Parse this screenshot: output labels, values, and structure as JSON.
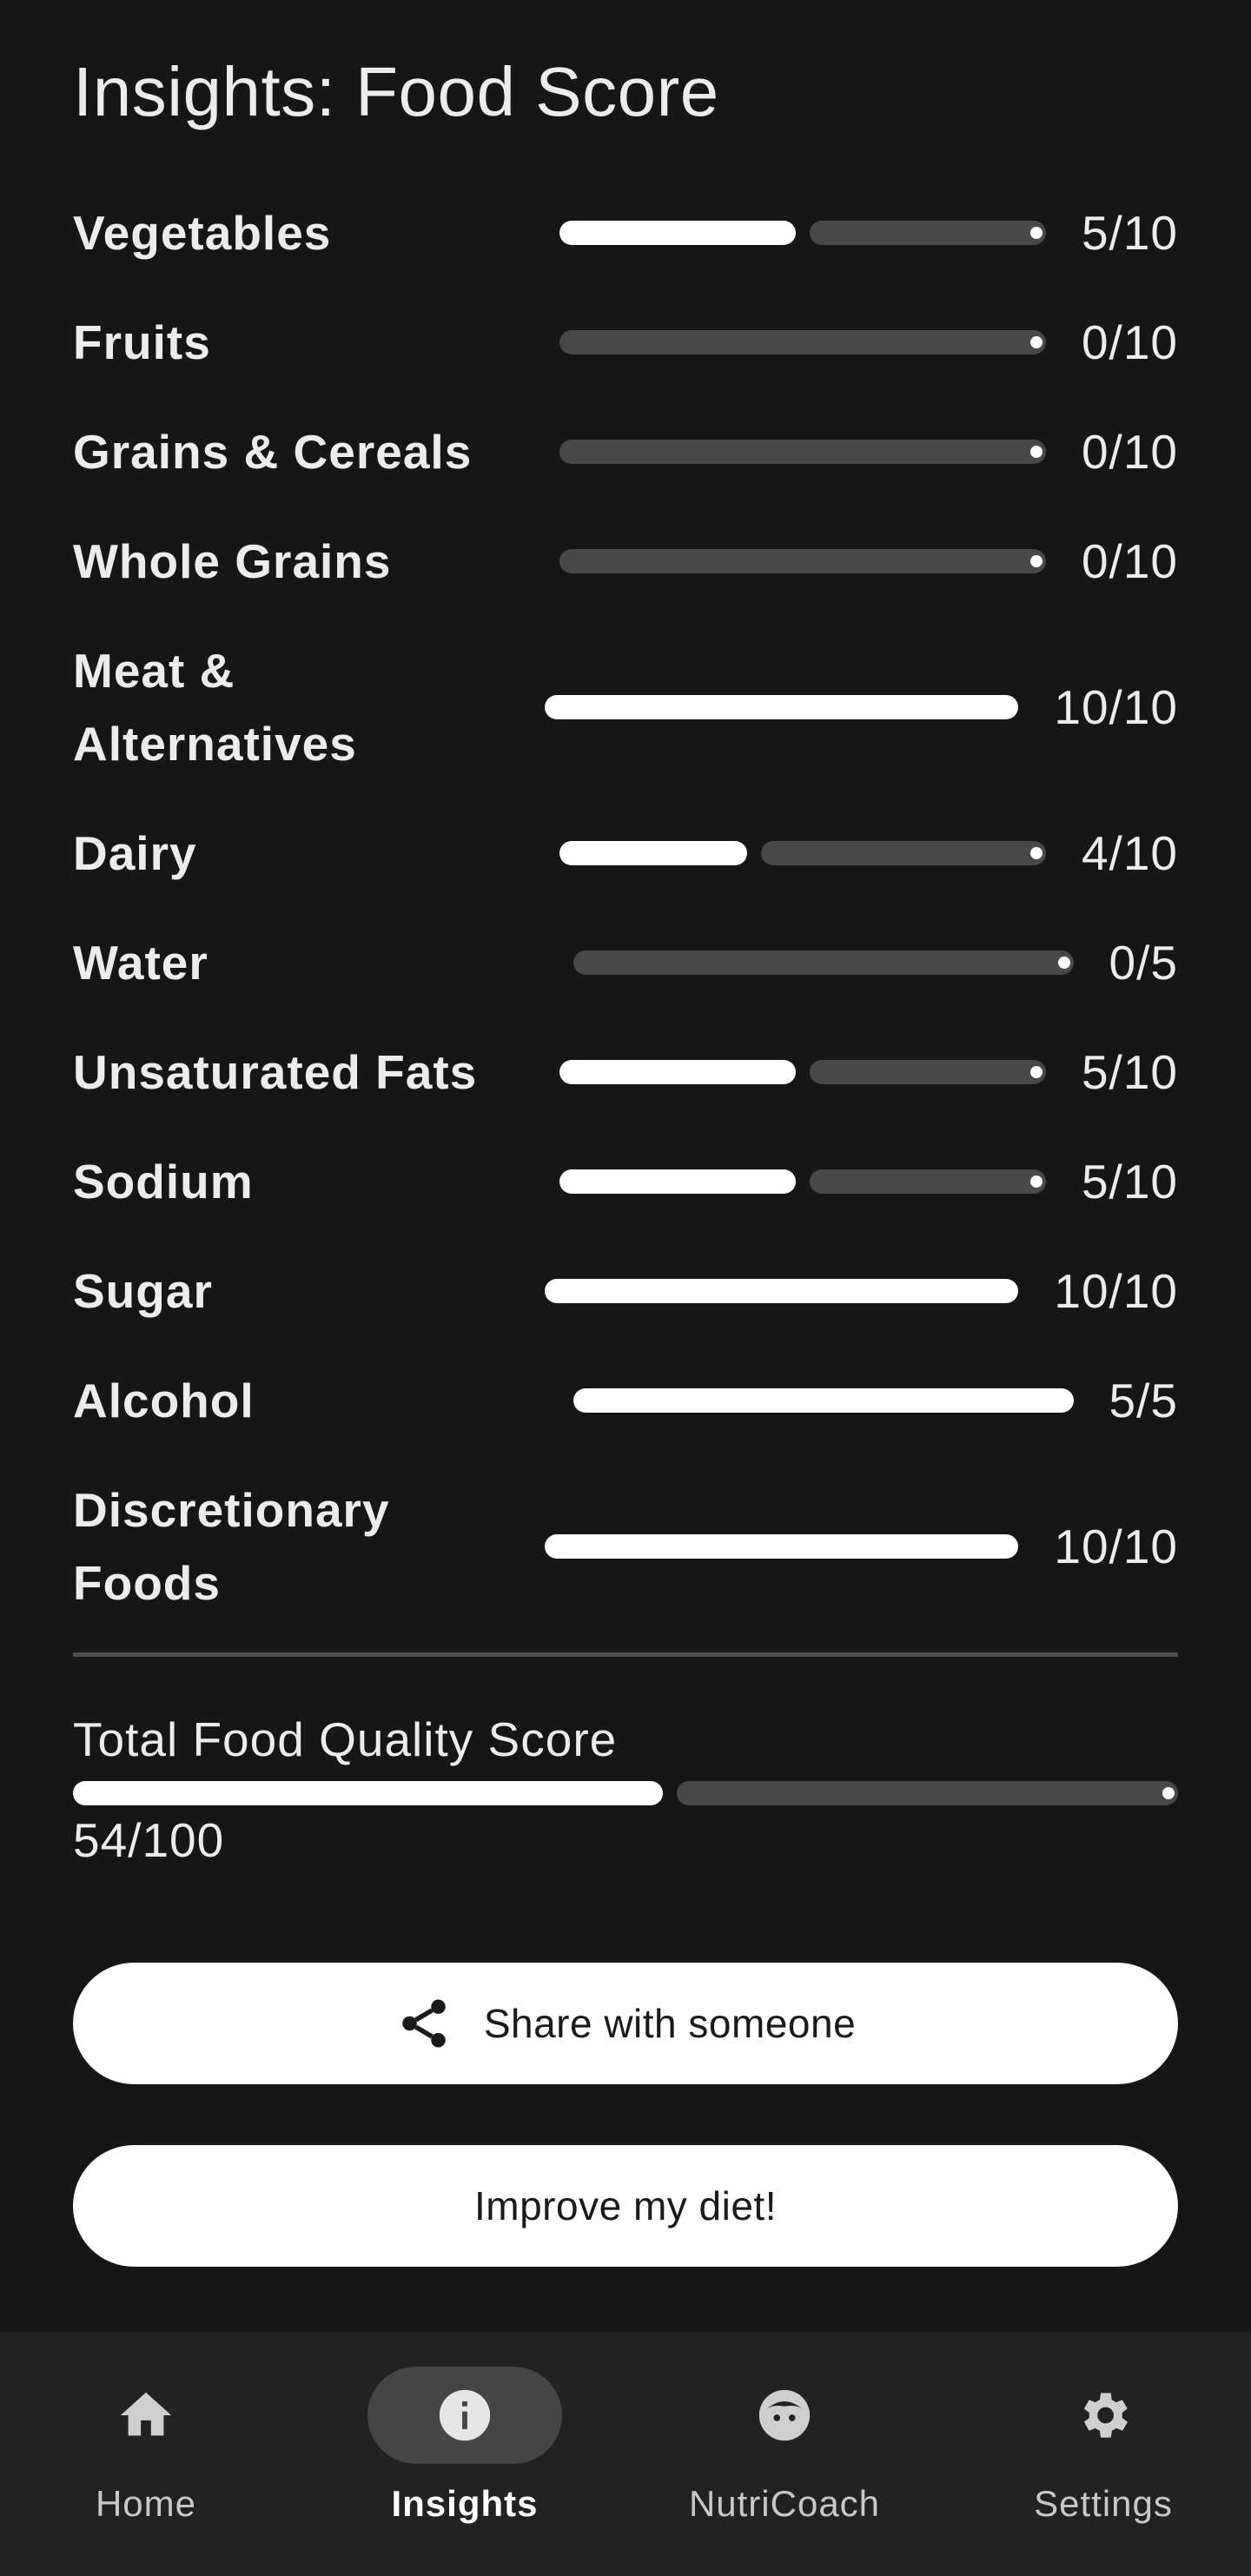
{
  "page": {
    "title": "Insights: Food Score"
  },
  "scores": [
    {
      "label": "Vegetables",
      "score": 5,
      "max": 10,
      "display": "5/10"
    },
    {
      "label": "Fruits",
      "score": 0,
      "max": 10,
      "display": "0/10"
    },
    {
      "label": "Grains & Cereals",
      "score": 0,
      "max": 10,
      "display": "0/10"
    },
    {
      "label": "Whole Grains",
      "score": 0,
      "max": 10,
      "display": "0/10"
    },
    {
      "label": "Meat & Alternatives",
      "score": 10,
      "max": 10,
      "display": "10/10"
    },
    {
      "label": "Dairy",
      "score": 4,
      "max": 10,
      "display": "4/10"
    },
    {
      "label": "Water",
      "score": 0,
      "max": 5,
      "display": "0/5"
    },
    {
      "label": "Unsaturated Fats",
      "score": 5,
      "max": 10,
      "display": "5/10"
    },
    {
      "label": "Sodium",
      "score": 5,
      "max": 10,
      "display": "5/10"
    },
    {
      "label": "Sugar",
      "score": 10,
      "max": 10,
      "display": "10/10"
    },
    {
      "label": "Alcohol",
      "score": 5,
      "max": 5,
      "display": "5/5"
    },
    {
      "label": "Discretionary Foods",
      "score": 10,
      "max": 10,
      "display": "10/10"
    }
  ],
  "total": {
    "label": "Total Food Quality Score",
    "score": 54,
    "max": 100,
    "display": "54/100"
  },
  "buttons": {
    "share_label": "Share with someone",
    "share_icon": "share-icon",
    "improve_label": "Improve my diet!"
  },
  "nav": {
    "items": [
      {
        "label": "Home",
        "icon": "home-icon",
        "active": false
      },
      {
        "label": "Insights",
        "icon": "info-icon",
        "active": true
      },
      {
        "label": "NutriCoach",
        "icon": "face-icon",
        "active": false
      },
      {
        "label": "Settings",
        "icon": "gear-icon",
        "active": false
      }
    ]
  },
  "colors": {
    "background": "#161616",
    "bar_fill": "#ffffff",
    "bar_track": "#484848",
    "navbar": "#222222",
    "nav_active_pill": "#454545"
  }
}
